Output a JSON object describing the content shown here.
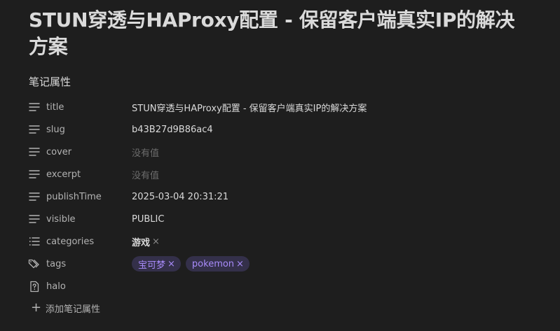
{
  "note": {
    "title": "STUN穿透与HAProxy配置 - 保留客户端真实IP的解决方案"
  },
  "properties_section": {
    "heading": "笔记属性",
    "add_label": "添加笔记属性",
    "rows": [
      {
        "key": "title",
        "icon": "text-lines-icon",
        "value": "STUN穿透与HAProxy配置 - 保留客户端真实IP的解决方案"
      },
      {
        "key": "slug",
        "icon": "text-lines-icon",
        "value": "b43B27d9B86ac4"
      },
      {
        "key": "cover",
        "icon": "text-lines-icon",
        "value": "没有值"
      },
      {
        "key": "excerpt",
        "icon": "text-lines-icon",
        "value": "没有值"
      },
      {
        "key": "publishTime",
        "icon": "text-lines-icon",
        "value": "2025-03-04 20:31:21"
      },
      {
        "key": "visible",
        "icon": "text-lines-icon",
        "value": "PUBLIC"
      },
      {
        "key": "categories",
        "icon": "list-icon",
        "value": "游戏",
        "remove": "×"
      },
      {
        "key": "tags",
        "icon": "tags-icon",
        "values": [
          "宝可梦",
          "pokemon"
        ],
        "remove": "×"
      },
      {
        "key": "halo",
        "icon": "question-file-icon"
      }
    ]
  },
  "colors": {
    "background": "#1e1e1e",
    "text": "#dadada",
    "muted": "#b3b3b3",
    "empty": "#6c6c6c",
    "tag_bg": "#34304a",
    "tag_text": "#a88bfa"
  }
}
